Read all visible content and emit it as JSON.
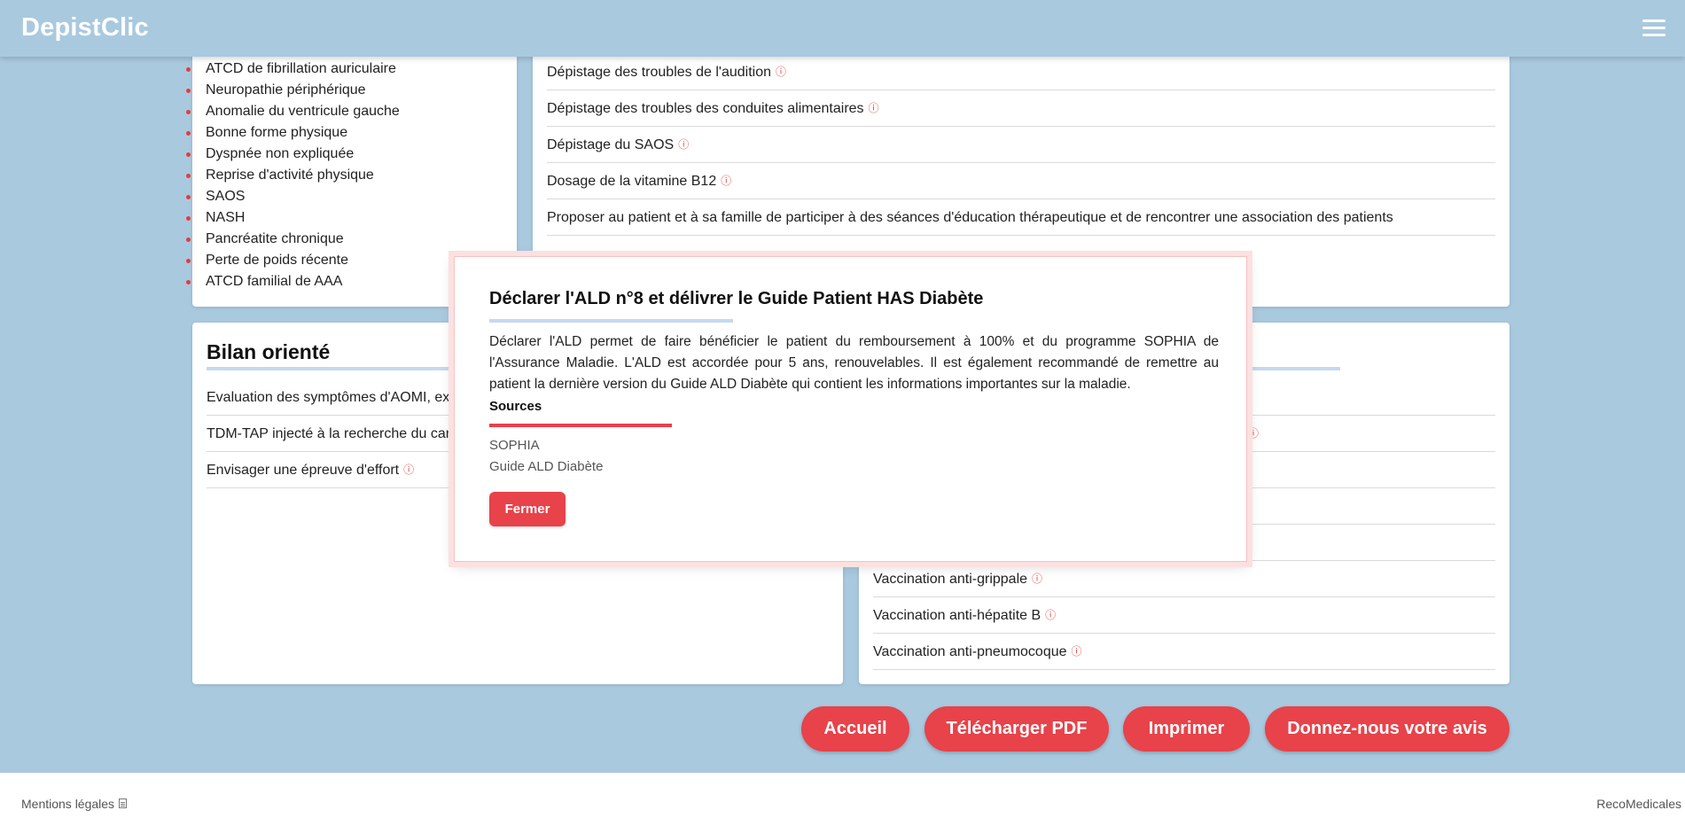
{
  "app": {
    "brand": "DepistClic"
  },
  "left_card": {
    "items": [
      "ATCD de fibrillation auriculaire",
      "Neuropathie périphérique",
      "Anomalie du ventricule gauche",
      "Bonne forme physique",
      "Dyspnée non expliquée",
      "Reprise d'activité physique",
      "SAOS",
      "NASH",
      "Pancréatite chronique",
      "Perte de poids récente",
      "ATCD familial de AAA"
    ]
  },
  "right_top_card": {
    "rows": [
      "Dépistage des troubles de l'audition",
      "Dépistage des troubles des conduites alimentaires",
      "Dépistage du SAOS",
      "Dosage de la vitamine B12",
      "Proposer au patient et à sa famille de participer à des séances d'éducation thérapeutique et de rencontrer une association des patients"
    ]
  },
  "bilan_card": {
    "title": "Bilan orienté",
    "rows": [
      "Evaluation des symptômes d'AOMI, exa",
      "TDM-TAP injecté à la recherche du canc",
      "Envisager une épreuve d'effort"
    ]
  },
  "right_bottom_card": {
    "rows": [
      "Vaccination anti-grippale",
      "Vaccination anti-hépatite B",
      "Vaccination anti-pneumocoque"
    ]
  },
  "info_icon": "ⓘ",
  "buttons": {
    "home": "Accueil",
    "download": "Télécharger PDF",
    "print": "Imprimer",
    "feedback": "Donnez-nous votre avis"
  },
  "footer": {
    "legal": "Mentions légales",
    "brand": "RecoMedicales"
  },
  "modal": {
    "title": "Déclarer l'ALD n°8 et délivrer le Guide Patient HAS Diabète",
    "text": "Déclarer l'ALD permet de faire bénéficier le patient du remboursement à 100% et du programme SOPHIA de l'Assurance Maladie. L'ALD est accordée pour 5 ans, renouvelables. Il est également recommandé de remettre au patient la dernière version du Guide ALD Diabète qui contient les informations importantes sur la maladie.",
    "sources_title": "Sources",
    "sources": [
      "SOPHIA",
      "Guide ALD Diabète"
    ],
    "close": "Fermer"
  },
  "colors": {
    "background": "#a9c9df",
    "accent": "#e8424a",
    "underline": "#c5d9f0"
  }
}
